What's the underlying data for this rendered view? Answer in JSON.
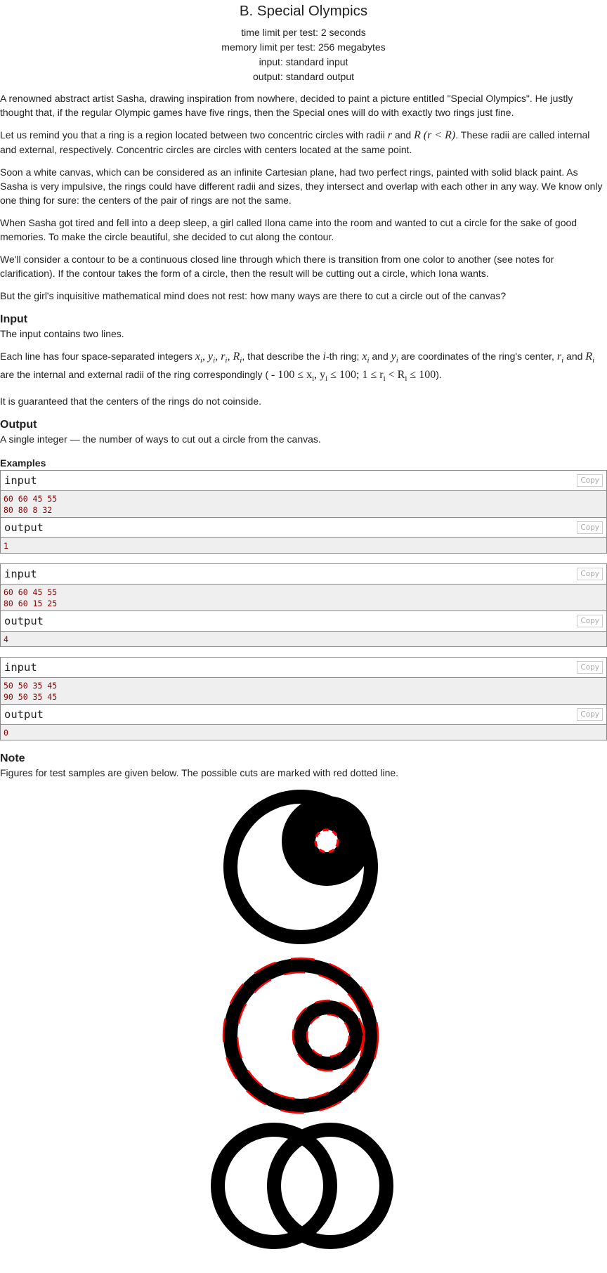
{
  "problem": {
    "title": "B. Special Olympics",
    "time_limit": "time limit per test: 2 seconds",
    "memory_limit": "memory limit per test: 256 megabytes",
    "input_file": "input: standard input",
    "output_file": "output: standard output"
  },
  "statement": {
    "p1": "A renowned abstract artist Sasha, drawing inspiration from nowhere, decided to paint a picture entitled \"Special Olympics\". He justly thought that, if the regular Olympic games have five rings, then the Special ones will do with exactly two rings just fine.",
    "p2a": "Let us remind you that a ring is a region located between two concentric circles with radii",
    "p2_r": "r",
    "p2_and": "and",
    "p2_R": "R",
    "p2_cond": "(r < R)",
    "p2b": ". These radii are called internal and external, respectively. Concentric circles are circles with centers located at the same point.",
    "p3": "Soon a white canvas, which can be considered as an infinite Cartesian plane, had two perfect rings, painted with solid black paint. As Sasha is very impulsive, the rings could have different radii and sizes, they intersect and overlap with each other in any way. We know only one thing for sure: the centers of the pair of rings are not the same.",
    "p4": "When Sasha got tired and fell into a deep sleep, a girl called Ilona came into the room and wanted to cut a circle for the sake of good memories. To make the circle beautiful, she decided to cut along the contour.",
    "p5": "We'll consider a contour to be a continuous closed line through which there is transition from one color to another (see notes for clarification). If the contour takes the form of a circle, then the result will be cutting out a circle, which Iona wants.",
    "p6": "But the girl's inquisitive mathematical mind does not rest: how many ways are there to cut a circle out of the canvas?"
  },
  "input_section": {
    "heading": "Input",
    "line1": "The input contains two lines.",
    "line2_a": "Each line has four space-separated integers",
    "line2_vars": "x",
    "line2_b": ", that describe the",
    "line2_i": "i",
    "line2_c": "-th ring;",
    "line2_d": "and",
    "line2_e": "are coordinates of the ring's center,",
    "line2_f": "and",
    "line2_g": "are the internal and external radii of the ring correspondingly (",
    "line2_constraints": "- 100 ≤ x",
    "line2_end": ").",
    "line3": "It is guaranteed that the centers of the rings do not coinside."
  },
  "output_section": {
    "heading": "Output",
    "line1": "A single integer — the number of ways to cut out a circle from the canvas."
  },
  "examples": {
    "heading": "Examples",
    "input_label": "input",
    "output_label": "output",
    "copy_label": "Copy",
    "tests": [
      {
        "input_lines": [
          "60 60 45 55",
          "80 80 8 32"
        ],
        "output": "1"
      },
      {
        "input_lines": [
          "60 60 45 55",
          "80 60 15 25"
        ],
        "output": "4"
      },
      {
        "input_lines": [
          "50 50 35 45",
          "90 50 35 45"
        ],
        "output": "0"
      }
    ]
  },
  "note": {
    "heading": "Note",
    "text": "Figures for test samples are given below. The possible cuts are marked with red dotted line."
  },
  "colors": {
    "ring": "#000000",
    "cut": "#ff0000",
    "sample_bg": "#efefef",
    "sample_text": "#8b0000"
  }
}
